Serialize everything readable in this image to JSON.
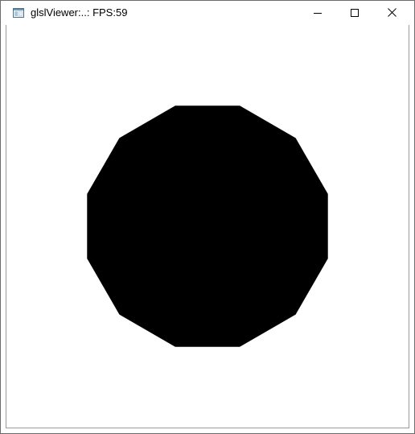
{
  "window": {
    "title": "glslViewer:..: FPS:59",
    "icon": "application-window-icon"
  },
  "caption_buttons": {
    "minimize": "minimize-icon",
    "maximize": "maximize-icon",
    "close": "close-icon"
  },
  "canvas": {
    "background_color": "#ffffff",
    "shape": {
      "type": "regular-polygon",
      "sides": 12,
      "fill_color": "#000000"
    }
  }
}
